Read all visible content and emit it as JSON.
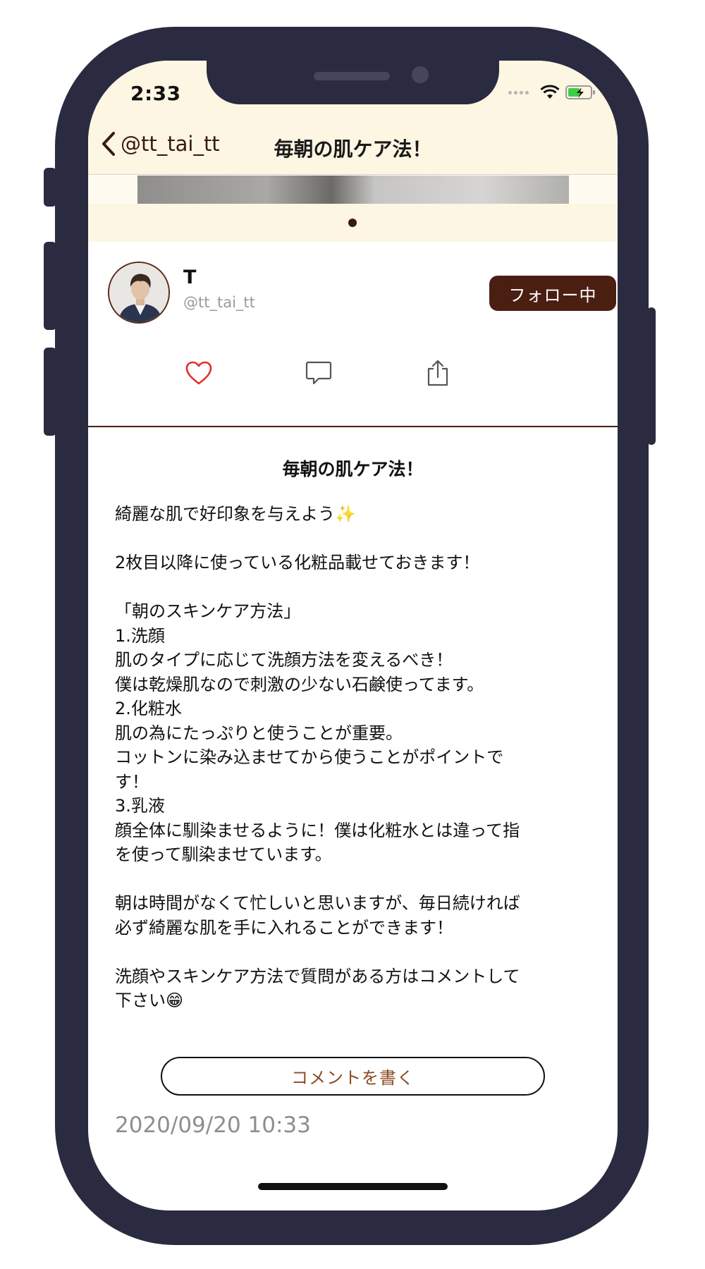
{
  "status_bar": {
    "time": "2:33",
    "signal_icon": "signal-dots-icon",
    "wifi_icon": "wifi-icon",
    "battery_icon": "battery-charging-icon"
  },
  "nav": {
    "back_label": "@tt_tai_tt",
    "back_icon": "chevron-left-icon",
    "title": "毎朝の肌ケア法！"
  },
  "author": {
    "name": "T",
    "handle": "@tt_tai_tt",
    "follow_label": "フォロー中"
  },
  "actions": {
    "like_icon": "heart-icon",
    "comment_icon": "speech-bubble-icon",
    "share_icon": "share-icon"
  },
  "post": {
    "title": "毎朝の肌ケア法！",
    "body": "綺麗な肌で好印象を与えよう✨\n\n2枚目以降に使っている化粧品載せておきます！\n\n「朝のスキンケア方法」\n1.洗顔\n肌のタイプに応じて洗顔方法を変えるべき！\n僕は乾燥肌なので刺激の少ない石鹸使ってます。\n2.化粧水\n肌の為にたっぷりと使うことが重要。\nコットンに染み込ませてから使うことがポイントで\nす！\n3.乳液\n顔全体に馴染ませるように！僕は化粧水とは違って指\nを使って馴染ませています。\n\n朝は時間がなくて忙しいと思いますが、毎日続ければ\n必ず綺麗な肌を手に入れることができます！\n\n洗顔やスキンケア方法で質問がある方はコメントして\n下さい😁",
    "comment_button_label": "コメントを書く",
    "date": "2020/09/20 10:33"
  },
  "colors": {
    "frame": "#2a2b40",
    "header_bg": "#fdf6e3",
    "accent_brown": "#4a1f12",
    "comment_text": "#8a4b22",
    "like_red": "#e0302a"
  }
}
